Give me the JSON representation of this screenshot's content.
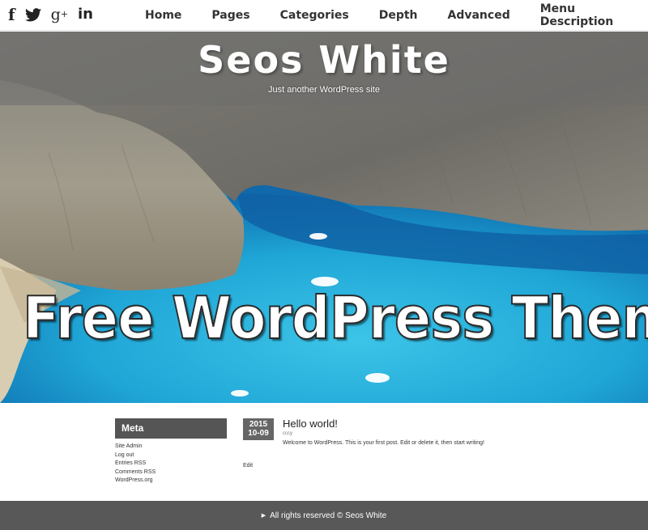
{
  "social": {
    "facebook": "f",
    "twitter": "🐦",
    "googleplus": "g",
    "googleplus_sup": "+",
    "linkedin": "in"
  },
  "nav": {
    "items": [
      "Home",
      "Pages",
      "Categories",
      "Depth",
      "Advanced",
      "Menu Description"
    ]
  },
  "hero": {
    "site_title": "Seos White",
    "tagline": "Just another WordPress site",
    "promo_text": "Free WordPress Theme"
  },
  "sidebar": {
    "widget_title": "Meta",
    "links": [
      "Site Admin",
      "Log out",
      "Entries RSS",
      "Comments RSS",
      "WordPress.org"
    ]
  },
  "post": {
    "date_year": "2015",
    "date_day": "10-09",
    "title": "Hello world!",
    "author": "cccy",
    "body": "Welcome to WordPress. This is your first post. Edit or delete it, then start writing!",
    "edit": "Edit"
  },
  "footer": {
    "arrow": "▶",
    "text": "All rights reserved © Seos White"
  },
  "colors": {
    "widget_bg": "#555555",
    "footer_bg": "#585858",
    "date_bg": "#666666",
    "sea": "#1aa8d8"
  }
}
